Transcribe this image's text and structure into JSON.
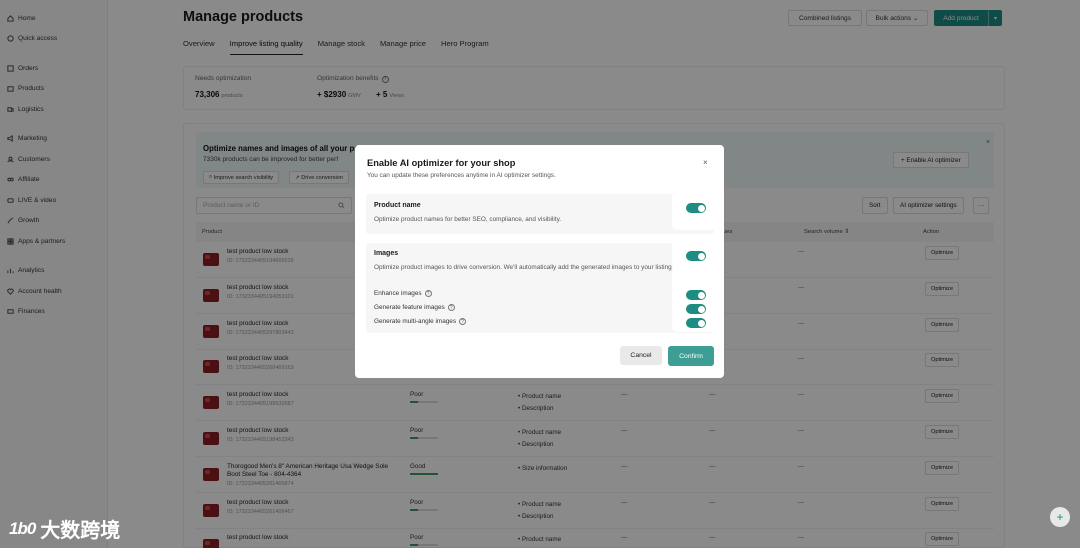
{
  "sidebar": {
    "items": [
      {
        "label": "Home",
        "icon": "home-icon"
      },
      {
        "label": "Quick access",
        "icon": "bolt-icon"
      },
      {
        "label": "Orders",
        "icon": "orders-icon"
      },
      {
        "label": "Products",
        "icon": "products-icon"
      },
      {
        "label": "Logistics",
        "icon": "truck-icon"
      },
      {
        "label": "Marketing",
        "icon": "megaphone-icon"
      },
      {
        "label": "Customers",
        "icon": "customers-icon"
      },
      {
        "label": "Affiliate",
        "icon": "affiliate-icon"
      },
      {
        "label": "LIVE & video",
        "icon": "video-icon"
      },
      {
        "label": "Growth",
        "icon": "growth-icon"
      },
      {
        "label": "Apps & partners",
        "icon": "apps-icon"
      },
      {
        "label": "Analytics",
        "icon": "analytics-icon"
      },
      {
        "label": "Account health",
        "icon": "health-icon"
      },
      {
        "label": "Finances",
        "icon": "finance-icon"
      }
    ]
  },
  "header": {
    "title": "Manage products",
    "combined_listings": "Combined listings",
    "bulk_actions": "Bulk actions",
    "add_product": "Add product"
  },
  "tabs": [
    "Overview",
    "Improve listing quality",
    "Manage stock",
    "Manage price",
    "Hero Program"
  ],
  "stats": {
    "needs_label": "Needs optimization",
    "needs_value": "73,306",
    "needs_unit": "products",
    "benefits_label": "Optimization benefits",
    "gmv_value": "+ $2930",
    "gmv_unit": "GMV",
    "views_value": "+ 5",
    "views_unit": "Views"
  },
  "banner": {
    "title": "Optimize names and images of all your pr",
    "subtitle": "7330k products can be improved for better perf",
    "pill1": "Improve search visibility",
    "pill2": "Drive conversion",
    "enable_btn": "+ Enable AI optimizer"
  },
  "toolbar": {
    "search_placeholder": "Product name or ID",
    "sort": "Sort",
    "settings": "AI optimizer settings",
    "more": "···"
  },
  "table": {
    "headers": {
      "product": "Product",
      "issues": "ues",
      "search_volume": "Search volume",
      "action": "Action"
    },
    "rows": [
      {
        "name": "test product low stock",
        "id": "ID: 1732334405194666535",
        "quality": "",
        "issues": [],
        "action": "Optimize"
      },
      {
        "name": "test product low stock",
        "id": "ID: 1732334405194053101",
        "quality": "",
        "issues": [],
        "action": "Optimize"
      },
      {
        "name": "test product low stock",
        "id": "ID: 1732334405297803443",
        "quality": "",
        "issues": [],
        "action": "Optimize"
      },
      {
        "name": "test product low stock",
        "id": "ID: 1732334405268469163",
        "quality": "",
        "issues": [],
        "action": "Optimize"
      },
      {
        "name": "test product low stock",
        "id": "ID: 1732334405199532687",
        "quality": "Poor",
        "issues": [
          "Product name",
          "Description"
        ],
        "action": "Optimize"
      },
      {
        "name": "test product low stock",
        "id": "ID: 1732334405198453343",
        "quality": "Poor",
        "issues": [
          "Product name",
          "Description"
        ],
        "action": "Optimize"
      },
      {
        "name": "Thorogood Men's 8\" American Heritage Usa Wedge Sole Boot Steel Toe - 804-4364",
        "id": "ID: 1732334405261466874",
        "quality": "Good",
        "issues": [
          "Size information"
        ],
        "action": "Optimize"
      },
      {
        "name": "test product low stock",
        "id": "ID: 1732334405261406467",
        "quality": "Poor",
        "issues": [
          "Product name",
          "Description"
        ],
        "action": "Optimize"
      },
      {
        "name": "test product low stock",
        "id": "",
        "quality": "Poor",
        "issues": [
          "Product name"
        ],
        "action": "Optimize"
      }
    ],
    "dash": "—"
  },
  "modal": {
    "title": "Enable AI optimizer for your shop",
    "subtitle": "You can update these preferences anytime in AI optimizer settings.",
    "section1_title": "Product name",
    "section1_desc": "Optimize product names for better SEO, compliance, and visibility.",
    "section2_title": "Images",
    "section2_desc": "Optimize product images to drive conversion. We'll automatically add the generated images to your listings.",
    "opt_enhance": "Enhance images",
    "opt_feature": "Generate feature images",
    "opt_multi": "Generate multi-angle images",
    "cancel": "Cancel",
    "confirm": "Confirm",
    "close": "×",
    "toggles": {
      "product_name": true,
      "images": true,
      "enhance": true,
      "feature": true,
      "multi_angle": true
    }
  },
  "watermark": {
    "logo": "1b0",
    "text": "大数跨境"
  },
  "colors": {
    "accent": "#1d8d84",
    "confirm": "#3e9e96",
    "overlay": "rgba(0,0,0,0.46)"
  }
}
